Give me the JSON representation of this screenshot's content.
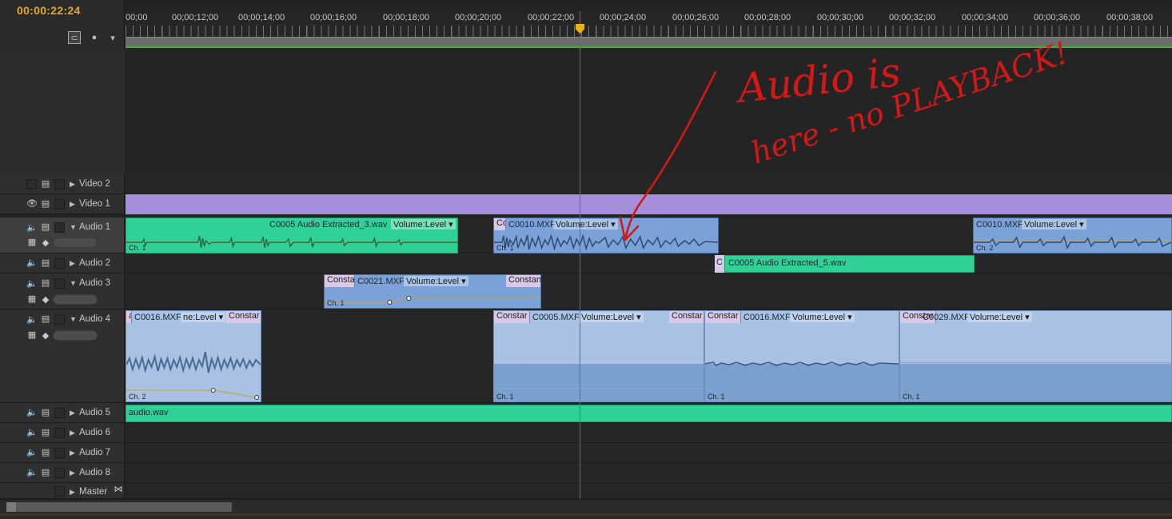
{
  "timecode": "00:00:22:24",
  "ruler_ticks": [
    "00;00",
    "00;00;12;00",
    "00;00;14;00",
    "00;00;16;00",
    "00;00;18;00",
    "00;00;20;00",
    "00;00;22;00",
    "00;00;24;00",
    "00;00;26;00",
    "00;00;28;00",
    "00;00;30;00",
    "00;00;32;00",
    "00;00;34;00",
    "00;00;36;00",
    "00;00;38;00"
  ],
  "header_icons": [
    "snap-icon",
    "add-marker-icon",
    "marker-icon"
  ],
  "tracks": {
    "video2": "Video 2",
    "video1": "Video 1",
    "audio1": "Audio 1",
    "audio2": "Audio 2",
    "audio3": "Audio 3",
    "audio4": "Audio 4",
    "audio5": "Audio 5",
    "audio6": "Audio 6",
    "audio7": "Audio 7",
    "audio8": "Audio 8",
    "master": "Master"
  },
  "clips": {
    "a1_c1": {
      "name": "C0005 Audio Extracted_3.wav",
      "vol": "Volume:Level ▾",
      "ch": "Ch. 1"
    },
    "a1_c2": {
      "pre": "Co",
      "name": "C0010.MXF",
      "vol": "Volume:Level ▾",
      "ch": "Ch. 1"
    },
    "a1_c3": {
      "name": "C0010.MXF",
      "vol": "Volume:Level ▾",
      "ch": "Ch. 2"
    },
    "a2_c1": {
      "pre": "C",
      "name": "C0005 Audio Extracted_5.wav"
    },
    "a3_c1": {
      "pre": "Consta",
      "name": "C0021.MXF",
      "vol": "Volume:Level ▾",
      "post": "Constan",
      "ch": "Ch. 1"
    },
    "a4_c1": {
      "pre": "ar",
      "name": "C0016.MXF",
      "vol": "ne:Level ▾",
      "post": "Constar",
      "ch": "Ch. 2"
    },
    "a4_c2": {
      "pre": "Constar",
      "name": "C0005.MXF",
      "vol": "Volume:Level ▾",
      "post": "Constar",
      "ch": "Ch. 1"
    },
    "a4_c3": {
      "pre": "Constar",
      "name": "C0016.MXF",
      "vol": "Volume:Level ▾",
      "ch": "Ch. 1"
    },
    "a4_c4": {
      "pre": "Constar",
      "name": "C0029.MXF",
      "vol": "Volume:Level ▾",
      "ch": "Ch. 1"
    },
    "a5_c1": {
      "name": "audio.wav"
    }
  },
  "annotation": {
    "line1": "Audio is",
    "line2": "here - no PLAYBACK!",
    "color": "#d41818"
  },
  "colors": {
    "timecode": "#e3a823",
    "playhead": "#d9422a",
    "video_clip": "#a58fdb",
    "audio_green": "#2fd196",
    "audio_blue": "#7ba2d8"
  }
}
